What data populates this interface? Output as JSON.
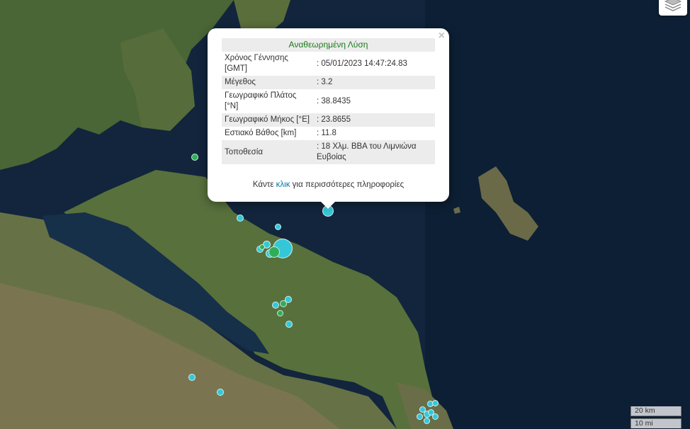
{
  "map": {
    "colors": {
      "sea": "#10233a",
      "land": "#556b3a",
      "land_dark": "#3d5a2c",
      "land_light": "#8a7a55",
      "quake_cyan": "#35c7d8",
      "quake_green": "#2fae5a"
    }
  },
  "layers_control": {
    "icon": "layers-icon"
  },
  "popup": {
    "title": "Αναθεωρημένη Λύση",
    "close": "×",
    "rows": [
      {
        "label": "Χρόνος Γέννησης [GMT]",
        "value": ": 05/01/2023 14:47:24.83"
      },
      {
        "label": "Μέγεθος",
        "value": ": 3.2"
      },
      {
        "label": "Γεωγραφικό Πλάτος [°N]",
        "value": ": 38.8435"
      },
      {
        "label": "Γεωγραφικό Μήκος [°E]",
        "value": ": 23.8655"
      },
      {
        "label": "Εστιακό Βάθος [km]",
        "value": ": 11.8"
      },
      {
        "label": "Τοποθεσία",
        "value": ": 18 Χλμ. ΒΒΑ του Λιμνιώνα Ευβοίας"
      }
    ],
    "more_before": "Κάντε ",
    "more_link": "κλικ",
    "more_after": " για περισσότερες πληροφορίες"
  },
  "scale": {
    "km": "20 km",
    "mi": "10 mi"
  }
}
